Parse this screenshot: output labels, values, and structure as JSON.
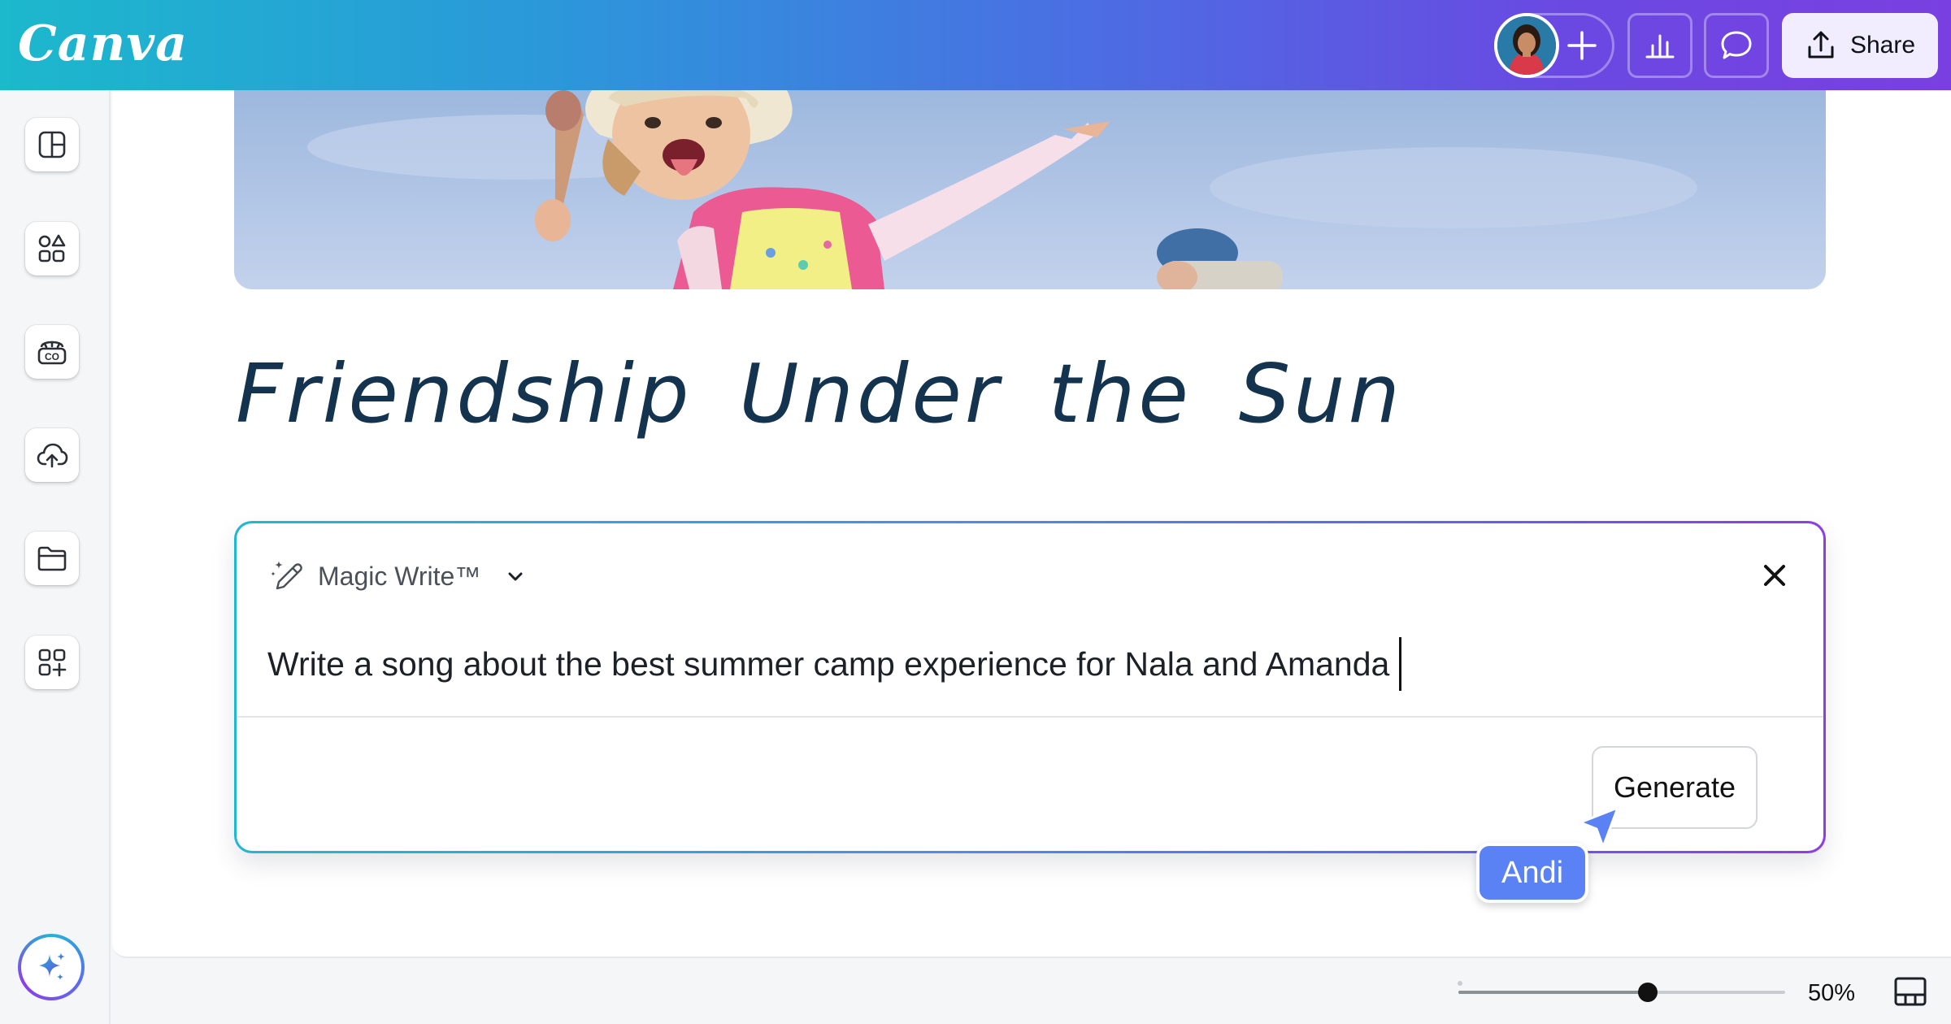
{
  "app": {
    "logo_text": "Canva",
    "brand_gradient": [
      "#1cb8cc",
      "#4a6fe3",
      "#7a3fe0"
    ]
  },
  "topbar": {
    "avatar_icon": "user-avatar",
    "add_collaborator_icon": "plus-icon",
    "insights_icon": "bar-chart-icon",
    "comments_icon": "speech-bubble-icon",
    "share_icon": "upload-icon",
    "share_label": "Share"
  },
  "sidebar": {
    "items": [
      {
        "icon": "design-layout-icon"
      },
      {
        "icon": "elements-shapes-icon"
      },
      {
        "icon": "brand-kit-icon"
      },
      {
        "icon": "cloud-upload-icon"
      },
      {
        "icon": "folder-icon"
      },
      {
        "icon": "apps-grid-icon"
      }
    ],
    "magic_icon": "sparkle-icon"
  },
  "canvas": {
    "title": "Friendship Under the Sun"
  },
  "magic_write": {
    "label": "Magic Write™",
    "prompt": "Write a song about the best summer camp experience for Nala and Amanda",
    "generate_label": "Generate",
    "collaborator_name": "Andi",
    "collaborator_color": "#5a82f5"
  },
  "footer": {
    "zoom_label": "50%",
    "zoom_level": 0.5
  }
}
